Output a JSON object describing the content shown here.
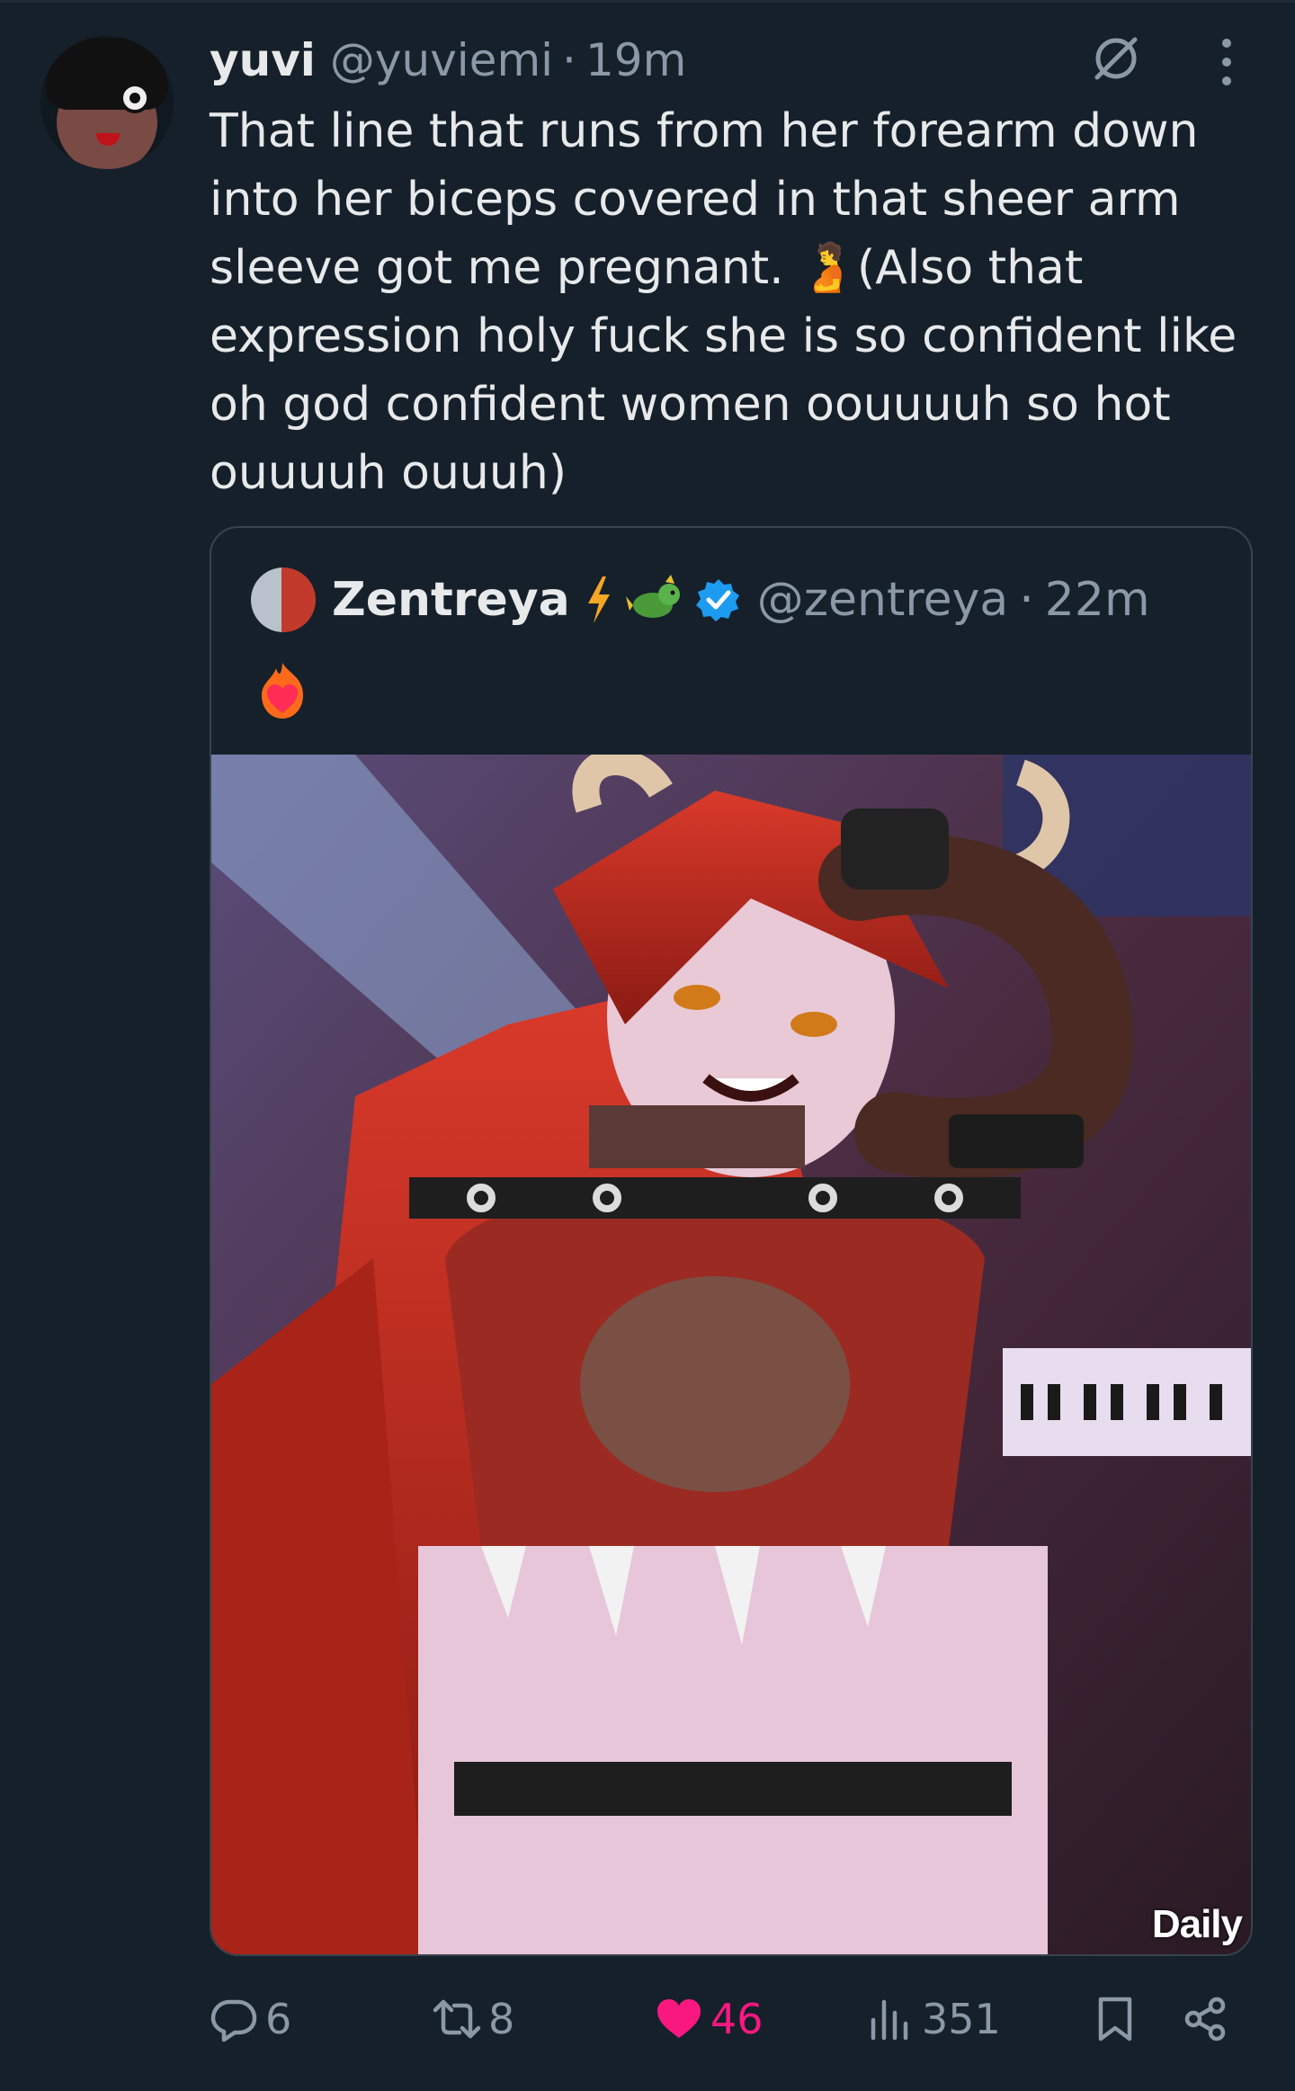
{
  "tweet": {
    "author_name": "yuvi",
    "author_handle": "@yuviemi",
    "separator": "·",
    "time": "19m",
    "text": "That line that runs from her forearm down\ninto her biceps covered in that sheer arm\nsleeve got me pregnant. 🫄(Also that\nexpression holy fuck she is so confident like\noh god confident women oouuuuh so hot\nouuuuh ouuuh)",
    "icons": {
      "hide": "hide-reply-icon",
      "more": "more-options-icon"
    }
  },
  "quote": {
    "author_name": "Zentreya",
    "author_handle": "@zentreya",
    "separator": "·",
    "time": "22m",
    "badges": [
      "lightning-icon",
      "dragon-icon",
      "verified-badge-icon"
    ],
    "emoji_icon": "heart-on-fire-icon",
    "media_watermark": "Daily"
  },
  "actions": {
    "reply_count": "6",
    "retweet_count": "8",
    "like_count": "46",
    "views_count": "351",
    "icons": [
      "reply-icon",
      "retweet-icon",
      "like-icon",
      "views-icon",
      "bookmark-icon",
      "share-icon"
    ]
  },
  "colors": {
    "background": "#15202b",
    "text": "#e7e9ea",
    "secondary_text": "#8b98a5",
    "like": "#f91880",
    "verified": "#1d9bf0",
    "border": "#38444d"
  }
}
